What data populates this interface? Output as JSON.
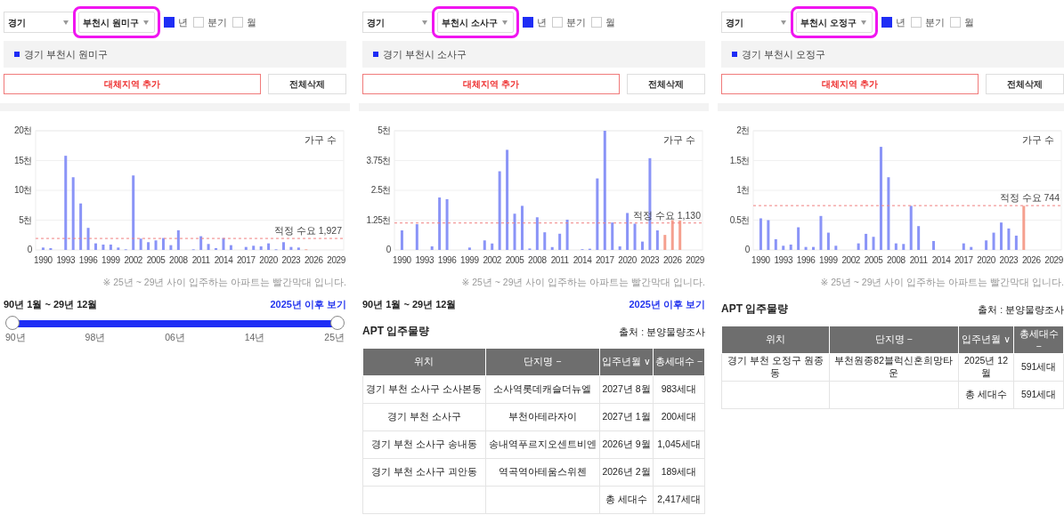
{
  "panels": [
    {
      "province": {
        "value": "경기"
      },
      "district": {
        "value": "부천시 원미구",
        "highlighted": true
      },
      "periods": [
        {
          "label": "년",
          "checked": true
        },
        {
          "label": "분기",
          "checked": false
        },
        {
          "label": "월",
          "checked": false
        }
      ],
      "legend": [
        {
          "label": "경기 부천시 원미구",
          "color": "#1e2df5"
        }
      ],
      "buttons": {
        "add": "대체지역 추가",
        "clear": "전체삭제"
      },
      "chart_data": {
        "type": "bar",
        "ylabel": "가구 수",
        "stacked": true,
        "x": [
          1990,
          1991,
          1993,
          1994,
          1995,
          1996,
          1997,
          1998,
          1999,
          2000,
          2001,
          2002,
          2003,
          2004,
          2005,
          2006,
          2007,
          2008,
          2010,
          2011,
          2012,
          2013,
          2014,
          2015,
          2017,
          2018,
          2019,
          2020,
          2021,
          2022,
          2023,
          2024,
          2025
        ],
        "series": [
          {
            "color": "#8a94f7",
            "values": [
              0.4,
              0.3,
              15.8,
              12.2,
              7.8,
              3.7,
              1.1,
              0.9,
              0.9,
              0.4,
              0.1,
              12.5,
              1.9,
              1.3,
              1.6,
              2.0,
              0.8,
              3.3,
              0.1,
              2.3,
              1.0,
              0.3,
              2.0,
              0.8,
              0.5,
              0.7,
              0.6,
              1.1,
              0.1,
              1.3,
              0.5,
              0.4,
              null
            ]
          },
          {
            "color": "#f5a08f",
            "values": [
              null,
              null,
              null,
              null,
              null,
              null,
              null,
              null,
              null,
              null,
              null,
              null,
              null,
              null,
              null,
              null,
              null,
              null,
              null,
              null,
              null,
              null,
              null,
              null,
              null,
              null,
              null,
              null,
              null,
              null,
              null,
              null,
              0.1
            ]
          }
        ],
        "xlim": [
          1989,
          2030
        ],
        "grid": true,
        "ylim": [
          0,
          20
        ],
        "yticks": [
          {
            "value": 0,
            "label": "0"
          },
          {
            "value": 5,
            "label": "5천"
          },
          {
            "value": 10,
            "label": "10천"
          },
          {
            "value": 15,
            "label": "15천"
          },
          {
            "value": 20,
            "label": "20천"
          }
        ],
        "xticks": [
          1990,
          1993,
          1996,
          1999,
          2002,
          2005,
          2008,
          2011,
          2014,
          2017,
          2020,
          2023,
          2026,
          2029
        ],
        "ref_lines": [
          {
            "axis": "y",
            "value": 1.927,
            "label": "적정 수요 1,927"
          }
        ]
      },
      "note": "※ 25년 ~ 29년 사이 입주하는 아파트는 빨간막대 입니다.",
      "range": {
        "label": "90년 1월 ~ 29년 12월",
        "link": "2025년 이후 보기"
      },
      "slider": {
        "level": 1,
        "ticks": [
          "90년",
          "98년",
          "06년",
          "14년",
          "25년"
        ]
      }
    },
    {
      "province": {
        "value": "경기"
      },
      "district": {
        "value": "부천시 소사구",
        "highlighted": true
      },
      "periods": [
        {
          "label": "년",
          "checked": true
        },
        {
          "label": "분기",
          "checked": false
        },
        {
          "label": "월",
          "checked": false
        }
      ],
      "legend": [
        {
          "label": "경기 부천시 소사구",
          "color": "#1e2df5"
        }
      ],
      "buttons": {
        "add": "대체지역 추가",
        "clear": "전체삭제"
      },
      "chart_data": {
        "type": "bar",
        "ylabel": "가구 수",
        "stacked": true,
        "x": [
          1990,
          1992,
          1994,
          1995,
          1996,
          1999,
          2001,
          2002,
          2003,
          2004,
          2005,
          2006,
          2007,
          2008,
          2009,
          2010,
          2011,
          2012,
          2014,
          2015,
          2016,
          2017,
          2018,
          2019,
          2020,
          2021,
          2022,
          2023,
          2024,
          2025,
          2026,
          2027
        ],
        "series": [
          {
            "color": "#8a94f7",
            "values": [
              0.82,
              1.08,
              0.15,
              2.2,
              2.13,
              0.1,
              0.4,
              0.27,
              3.3,
              4.2,
              1.52,
              1.85,
              0.06,
              1.37,
              0.74,
              0.12,
              0.68,
              1.27,
              0.03,
              0.05,
              3.0,
              5.0,
              1.15,
              0.15,
              1.55,
              1.1,
              0.35,
              3.85,
              0.82,
              null,
              null,
              null
            ]
          },
          {
            "color": "#f5a08f",
            "values": [
              null,
              null,
              null,
              null,
              null,
              null,
              null,
              null,
              null,
              null,
              null,
              null,
              null,
              null,
              null,
              null,
              null,
              null,
              null,
              null,
              null,
              null,
              null,
              null,
              null,
              null,
              null,
              null,
              null,
              0.63,
              1.25,
              1.23
            ]
          }
        ],
        "xlim": [
          1989,
          2030
        ],
        "grid": true,
        "ylim": [
          0,
          5
        ],
        "yticks": [
          {
            "value": 0,
            "label": "0"
          },
          {
            "value": 1.25,
            "label": "1.25천"
          },
          {
            "value": 2.5,
            "label": "2.5천"
          },
          {
            "value": 3.75,
            "label": "3.75천"
          },
          {
            "value": 5,
            "label": "5천"
          }
        ],
        "xticks": [
          1990,
          1993,
          1996,
          1999,
          2002,
          2005,
          2008,
          2011,
          2014,
          2017,
          2020,
          2023,
          2026,
          2029
        ],
        "ref_lines": [
          {
            "axis": "y",
            "value": 1.13,
            "label": "적정 수요 1,130"
          }
        ]
      },
      "note": "※ 25년 ~ 29년 사이 입주하는 아파트는 빨간막대 입니다.",
      "range": {
        "label": "90년 1월 ~ 29년 12월",
        "link": "2025년 이후 보기"
      },
      "table": {
        "title": "APT 입주물량",
        "source": "출처 : 분양물량조사",
        "columns": [
          "위치",
          "단지명 −",
          "입주년월 ∨",
          "총세대수 −"
        ],
        "rows": [
          {
            "kind": "item",
            "cells": [
              "경기 부천 소사구 소사본동",
              "소사역롯데캐슬더뉴엘",
              "2027년 8월",
              "983세대"
            ]
          },
          {
            "kind": "item",
            "cells": [
              "경기 부천 소사구",
              "부천아테라자이",
              "2027년 1월",
              "200세대"
            ]
          },
          {
            "kind": "item",
            "cells": [
              "경기 부천 소사구 송내동",
              "송내역푸르지오센트비엔",
              "2026년 9월",
              "1,045세대"
            ]
          },
          {
            "kind": "item",
            "cells": [
              "경기 부천 소사구 괴안동",
              "역곡역아테움스위첸",
              "2026년 2월",
              "189세대"
            ]
          },
          {
            "kind": "total",
            "label": "총 세대수",
            "value": "2,417세대"
          }
        ]
      }
    },
    {
      "province": {
        "value": "경기"
      },
      "district": {
        "value": "부천시 오정구",
        "highlighted": true
      },
      "periods": [
        {
          "label": "년",
          "checked": true
        },
        {
          "label": "분기",
          "checked": false
        },
        {
          "label": "월",
          "checked": false
        }
      ],
      "legend": [
        {
          "label": "경기 부천시 오정구",
          "color": "#1e2df5"
        }
      ],
      "buttons": {
        "add": "대체지역 추가",
        "clear": "전체삭제"
      },
      "chart_data": {
        "type": "bar",
        "ylabel": "가구 수",
        "stacked": true,
        "x": [
          1990,
          1991,
          1992,
          1993,
          1994,
          1995,
          1996,
          1997,
          1998,
          1999,
          2000,
          2003,
          2004,
          2005,
          2006,
          2007,
          2008,
          2009,
          2010,
          2011,
          2013,
          2017,
          2018,
          2020,
          2021,
          2022,
          2023,
          2024,
          2025
        ],
        "series": [
          {
            "color": "#8a94f7",
            "values": [
              0.53,
              0.5,
              0.18,
              0.07,
              0.09,
              0.38,
              0.05,
              0.05,
              0.57,
              0.29,
              0.07,
              0.11,
              0.27,
              0.22,
              1.73,
              1.22,
              0.11,
              0.1,
              0.74,
              0.4,
              0.15,
              0.11,
              0.05,
              0.16,
              0.29,
              0.46,
              0.36,
              0.24,
              null
            ]
          },
          {
            "color": "#f5a08f",
            "values": [
              null,
              null,
              null,
              null,
              null,
              null,
              null,
              null,
              null,
              null,
              null,
              null,
              null,
              null,
              null,
              null,
              null,
              null,
              null,
              null,
              null,
              null,
              null,
              null,
              null,
              null,
              null,
              null,
              0.74
            ]
          }
        ],
        "xlim": [
          1989,
          2030
        ],
        "grid": true,
        "ylim": [
          0,
          2
        ],
        "yticks": [
          {
            "value": 0,
            "label": "0"
          },
          {
            "value": 0.5,
            "label": "0.5천"
          },
          {
            "value": 1,
            "label": "1천"
          },
          {
            "value": 1.5,
            "label": "1.5천"
          },
          {
            "value": 2,
            "label": "2천"
          }
        ],
        "xticks": [
          1990,
          1993,
          1996,
          1999,
          2002,
          2005,
          2008,
          2011,
          2014,
          2017,
          2020,
          2023,
          2026,
          2029
        ],
        "ref_lines": [
          {
            "axis": "y",
            "value": 0.744,
            "label": "적정 수요 744"
          }
        ]
      },
      "note": "※ 25년 ~ 29년 사이 입주하는 아파트는 빨간막대 입니다.",
      "table": {
        "title": "APT 입주물량",
        "source": "출처 : 분양물량조사",
        "columns": [
          "위치",
          "단지명 −",
          "입주년월 ∨",
          "총세대수 −"
        ],
        "rows": [
          {
            "kind": "item",
            "cells": [
              "경기 부천 오정구 원종동",
              "부천원종82블럭신혼희망타운",
              "2025년 12월",
              "591세대"
            ]
          },
          {
            "kind": "total",
            "label": "총 세대수",
            "value": "591세대"
          }
        ]
      }
    }
  ]
}
